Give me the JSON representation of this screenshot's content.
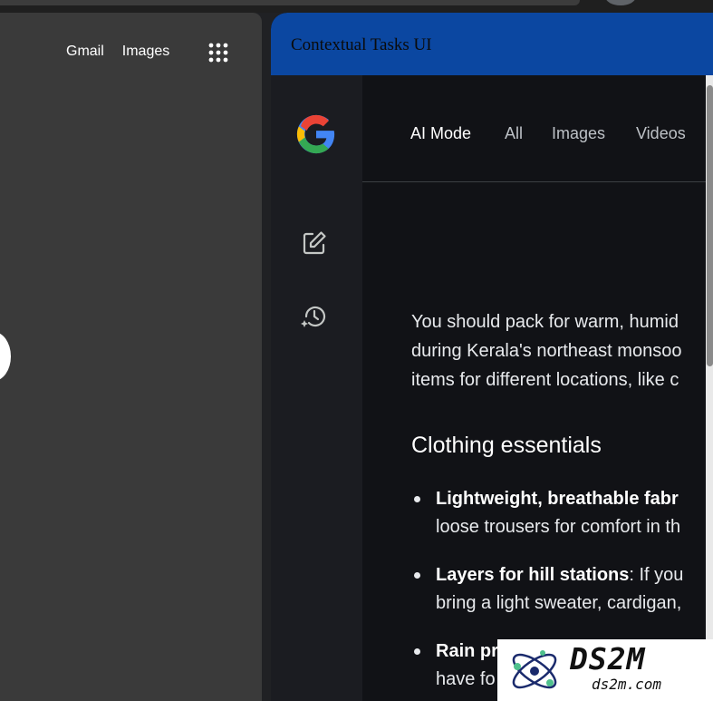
{
  "left_page": {
    "links": [
      "Gmail",
      "Images"
    ],
    "apps_icon": "apps-grid-icon"
  },
  "panel": {
    "title": "Contextual Tasks UI",
    "header_color": "#0b47a1",
    "logo": "google-g-icon",
    "rail_icons": [
      "edit-icon",
      "history-icon"
    ],
    "tabs": [
      {
        "label": "AI Mode",
        "active": true
      },
      {
        "label": "All",
        "active": false
      },
      {
        "label": "Images",
        "active": false
      },
      {
        "label": "Videos",
        "active": false
      }
    ]
  },
  "content": {
    "paragraph_lines": [
      "You should pack for warm, humid",
      "during Kerala's northeast monsoo",
      "items for different locations, like c"
    ],
    "section_title": "Clothing essentials",
    "bullets": [
      {
        "bold": "Lightweight, breathable fabr",
        "rest": "",
        "line2": "loose trousers for comfort in th"
      },
      {
        "bold": "Layers for hill stations",
        "rest": ": If you",
        "line2": "bring a light sweater, cardigan,"
      },
      {
        "bold": "Rain pr",
        "rest": "",
        "line2": "have fo"
      }
    ]
  },
  "watermark": {
    "big": "DS2M",
    "small": "ds2m.com"
  }
}
